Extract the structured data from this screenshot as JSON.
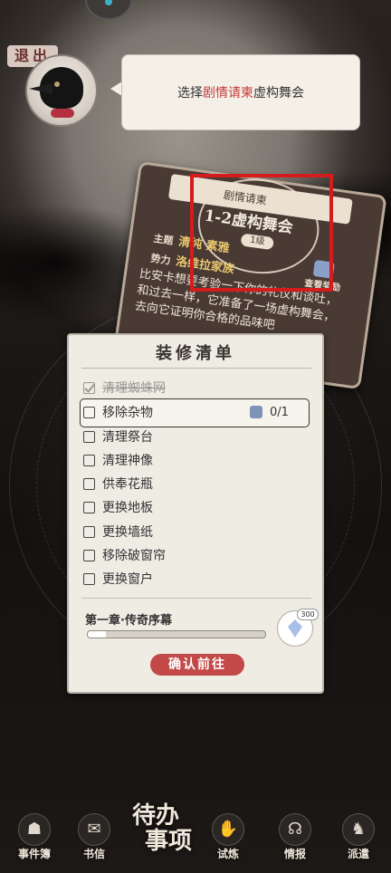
{
  "header": {
    "back_label": "退出"
  },
  "dialog": {
    "prefix": "选择",
    "highlight": "剧情请柬",
    "suffix": "虚构舞会",
    "highlight_color": "#c33a3a"
  },
  "story_card": {
    "small_title": "剧情请柬",
    "title": "1-2虚构舞会",
    "level": "1级",
    "theme_label": "主题",
    "theme_value": "清纯 素雅",
    "faction_label": "势力",
    "faction_value": "洛维拉家族",
    "reward_label": "查看奖励",
    "description": "比安卡想要考验一下你的礼仪和谈吐，和过去一样，它准备了一场虚构舞会，去向它证明你合格的品味吧"
  },
  "checklist": {
    "title": "装修清单",
    "tasks": [
      {
        "label": "清理蜘蛛网",
        "done": true
      },
      {
        "label": "移除杂物",
        "done": false,
        "count": "0/1"
      },
      {
        "label": "清理祭台",
        "done": false
      },
      {
        "label": "清理神像",
        "done": false
      },
      {
        "label": "供奉花瓶",
        "done": false
      },
      {
        "label": "更换地板",
        "done": false
      },
      {
        "label": "更换墙纸",
        "done": false
      },
      {
        "label": "移除破窗帘",
        "done": false
      },
      {
        "label": "更换窗户",
        "done": false
      }
    ],
    "chapter_label": "第一章·传奇序幕",
    "chapter_progress": 0.1,
    "chapter_reward": "300",
    "confirm_label": "确认前往"
  },
  "bottom_nav": {
    "items": [
      {
        "label": "事件簿",
        "icon": "book-icon"
      },
      {
        "label": "书信",
        "icon": "letter-icon"
      },
      {
        "label": "试炼",
        "icon": "trial-icon"
      },
      {
        "label": "情报",
        "icon": "intel-icon"
      },
      {
        "label": "派遣",
        "icon": "dispatch-icon"
      }
    ],
    "center_line1": "待办",
    "center_line2": "事项"
  }
}
